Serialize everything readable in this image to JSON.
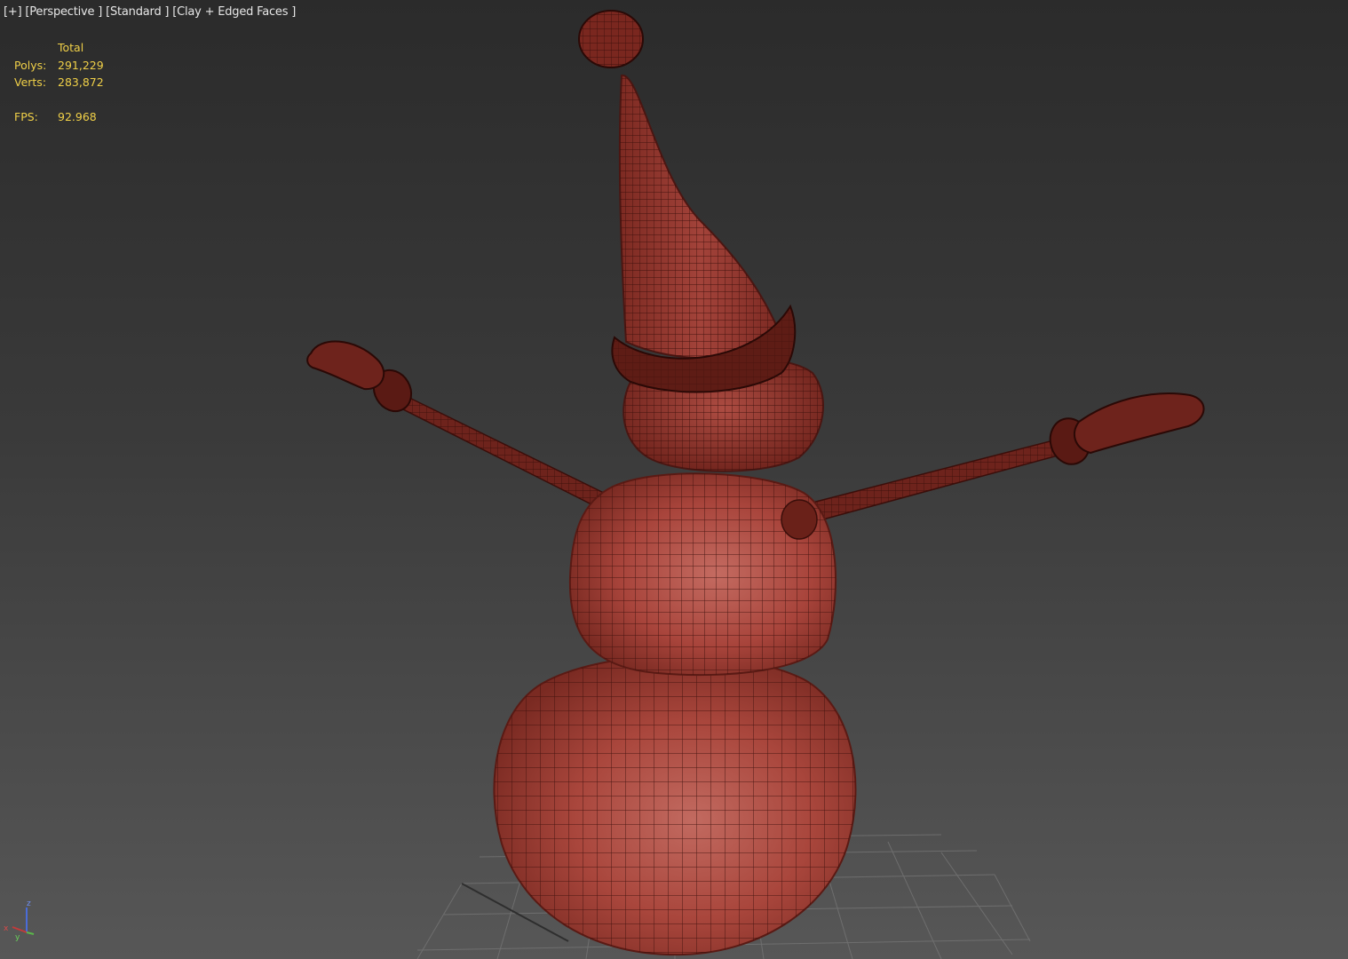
{
  "viewport": {
    "labels": {
      "plus": "[+]",
      "view": "[Perspective ]",
      "shading": "[Standard ]",
      "style": "[Clay + Edged Faces ]"
    },
    "stats": {
      "header": "Total",
      "polys_label": "Polys:",
      "polys_value": "291,229",
      "verts_label": "Verts:",
      "verts_value": "283,872",
      "fps_label": "FPS:",
      "fps_value": "92.968"
    },
    "axis": {
      "x": "x",
      "y": "y",
      "z": "z"
    }
  },
  "colors": {
    "clay": "#a8443b",
    "clay_dark": "#4a1612",
    "wire": "#3a0e0a",
    "stat_text": "#f0d048",
    "label_text": "#e6e6e6"
  }
}
